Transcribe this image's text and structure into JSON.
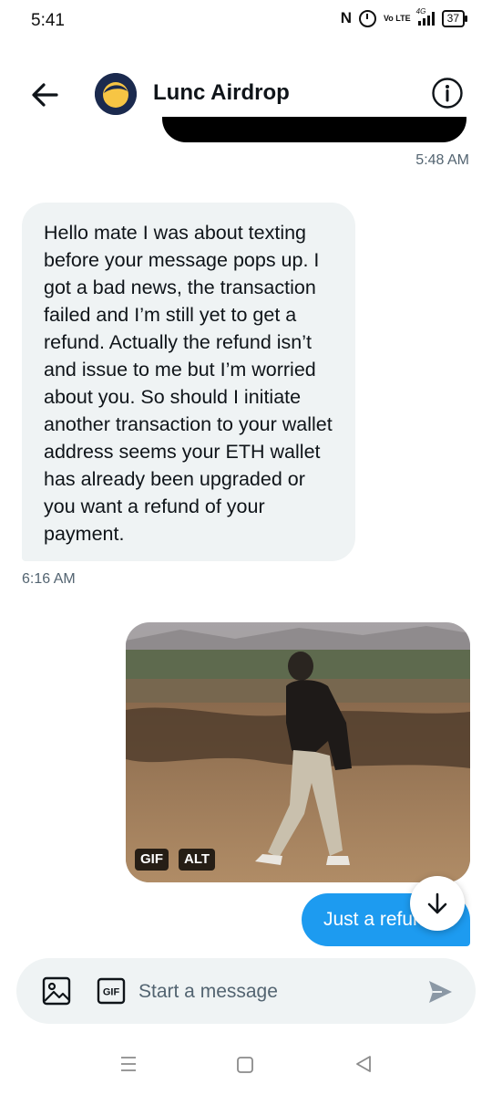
{
  "status_bar": {
    "time": "5:41",
    "nfc": "N",
    "volte": "Vo LTE",
    "network": "4G",
    "battery": "37"
  },
  "header": {
    "title": "Lunc Airdrop",
    "avatar_icon": "terra-luna-logo-icon"
  },
  "conversation": {
    "messages": [
      {
        "direction": "sent",
        "type": "text",
        "text": "",
        "timestamp": "5:48 AM"
      },
      {
        "direction": "received",
        "type": "text",
        "text": "Hello mate I was about texting before your message pops up. I got a bad news, the transaction failed and I’m still yet to get a refund. Actually the refund isn’t and issue to me but I’m worried about you. So should I initiate another transaction to your wallet address seems your ETH wallet has already been upgraded or you want a refund of your payment.",
        "timestamp": "6:16 AM"
      },
      {
        "direction": "sent",
        "type": "gif",
        "badges": [
          "GIF",
          "ALT"
        ]
      },
      {
        "direction": "sent",
        "type": "text",
        "text": "Just a refund"
      }
    ]
  },
  "composer": {
    "placeholder": "Start a message",
    "gif_label": "GIF"
  },
  "colors": {
    "accent": "#1d9bf0",
    "received_bubble": "#eff3f4",
    "secondary_text": "#536471"
  }
}
